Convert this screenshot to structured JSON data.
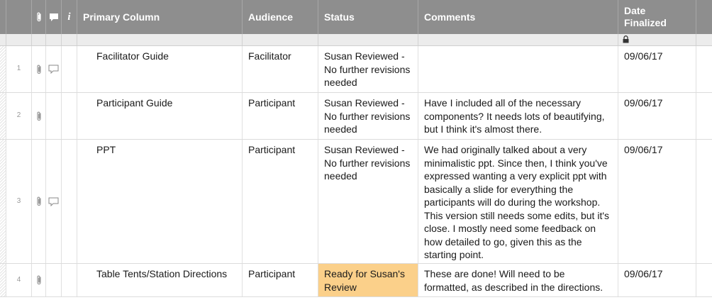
{
  "columns": {
    "primary": "Primary Column",
    "audience": "Audience",
    "status": "Status",
    "comments": "Comments",
    "date_line1": "Date",
    "date_line2": "Finalized"
  },
  "header_icons": [
    "paperclip-icon",
    "comment-icon",
    "info-icon"
  ],
  "info_glyph": "i",
  "rows": [
    {
      "number": "1",
      "primary": "Facilitator Guide",
      "audience": "Facilitator",
      "status": "Susan Reviewed - No further revisions needed",
      "comments": "",
      "date": "09/06/17",
      "has_attachment": true,
      "has_comment": true
    },
    {
      "number": "2",
      "primary": "Participant Guide",
      "audience": "Participant",
      "status": "Susan Reviewed - No further revisions needed",
      "comments": "Have I included all of the necessary components? It needs lots of beautifying, but I think it's almost there.",
      "date": "09/06/17",
      "has_attachment": true,
      "has_comment": false
    },
    {
      "number": "3",
      "primary": "PPT",
      "audience": "Participant",
      "status": "Susan Reviewed - No further revisions needed",
      "comments": "We had originally talked about a very minimalistic ppt. Since then, I think you've expressed wanting a very explicit ppt with basically a slide for everything the participants will do during the workshop. This version still needs some edits, but it's close. I mostly need some feedback on how detailed to go, given this as the starting point.",
      "date": "09/06/17",
      "has_attachment": true,
      "has_comment": true
    },
    {
      "number": "4",
      "primary": "Table Tents/Station Directions",
      "audience": "Participant",
      "status": "Ready for Susan's Review",
      "comments": "These are done! Will need to be formatted, as described in the directions.",
      "date": "09/06/17",
      "has_attachment": true,
      "has_comment": false
    }
  ],
  "colors": {
    "header_bg": "#8e8e8e",
    "status_ready_bg": "#fbd08a"
  },
  "locked_column": "date-finalized"
}
